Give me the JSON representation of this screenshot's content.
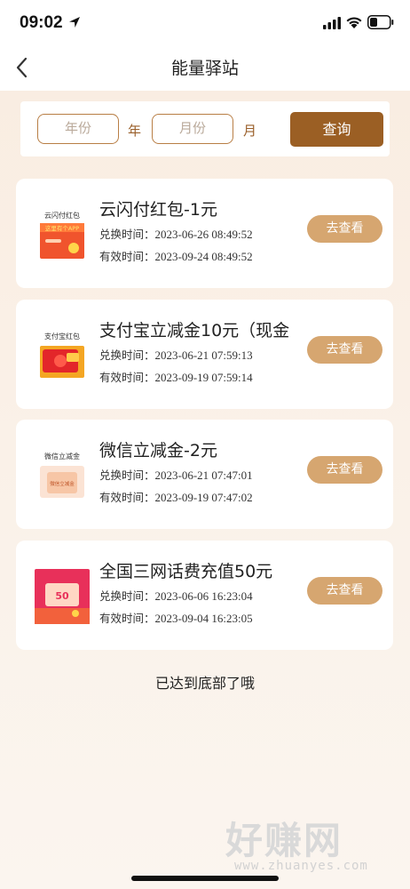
{
  "status_bar": {
    "time": "09:02"
  },
  "nav": {
    "title": "能量驿站"
  },
  "filter": {
    "year_placeholder": "年份",
    "year_unit": "年",
    "month_placeholder": "月份",
    "month_unit": "月",
    "query_label": "查询"
  },
  "cards": [
    {
      "title": "云闪付红包-1元",
      "redeem_label": "兑换时间：",
      "redeem_time": "2023-06-26 08:49:52",
      "valid_label": "有效时间：",
      "valid_time": "2023-09-24 08:49:52",
      "button": "去查看",
      "thumb_caption": "云闪付红包",
      "thumb_text": "这里有个APP"
    },
    {
      "title": "支付宝立减金10元（现金",
      "redeem_label": "兑换时间：",
      "redeem_time": "2023-06-21 07:59:13",
      "valid_label": "有效时间：",
      "valid_time": "2023-09-19 07:59:14",
      "button": "去查看",
      "thumb_caption": "支付宝红包"
    },
    {
      "title": "微信立减金-2元",
      "redeem_label": "兑换时间：",
      "redeem_time": "2023-06-21 07:47:01",
      "valid_label": "有效时间：",
      "valid_time": "2023-09-19 07:47:02",
      "button": "去查看",
      "thumb_caption": "微信立减金",
      "thumb_text": "微信立减金"
    },
    {
      "title": "全国三网话费充值50元",
      "redeem_label": "兑换时间：",
      "redeem_time": "2023-06-06 16:23:04",
      "valid_label": "有效时间：",
      "valid_time": "2023-09-04 16:23:05",
      "button": "去查看",
      "thumb_text": "50"
    }
  ],
  "end_text": "已达到底部了哦",
  "watermark": {
    "name": "好赚网",
    "url": "www.zhuanyes.com"
  },
  "colors": {
    "accent": "#9b5f24",
    "button": "#d6a670",
    "border": "#b87e45"
  }
}
